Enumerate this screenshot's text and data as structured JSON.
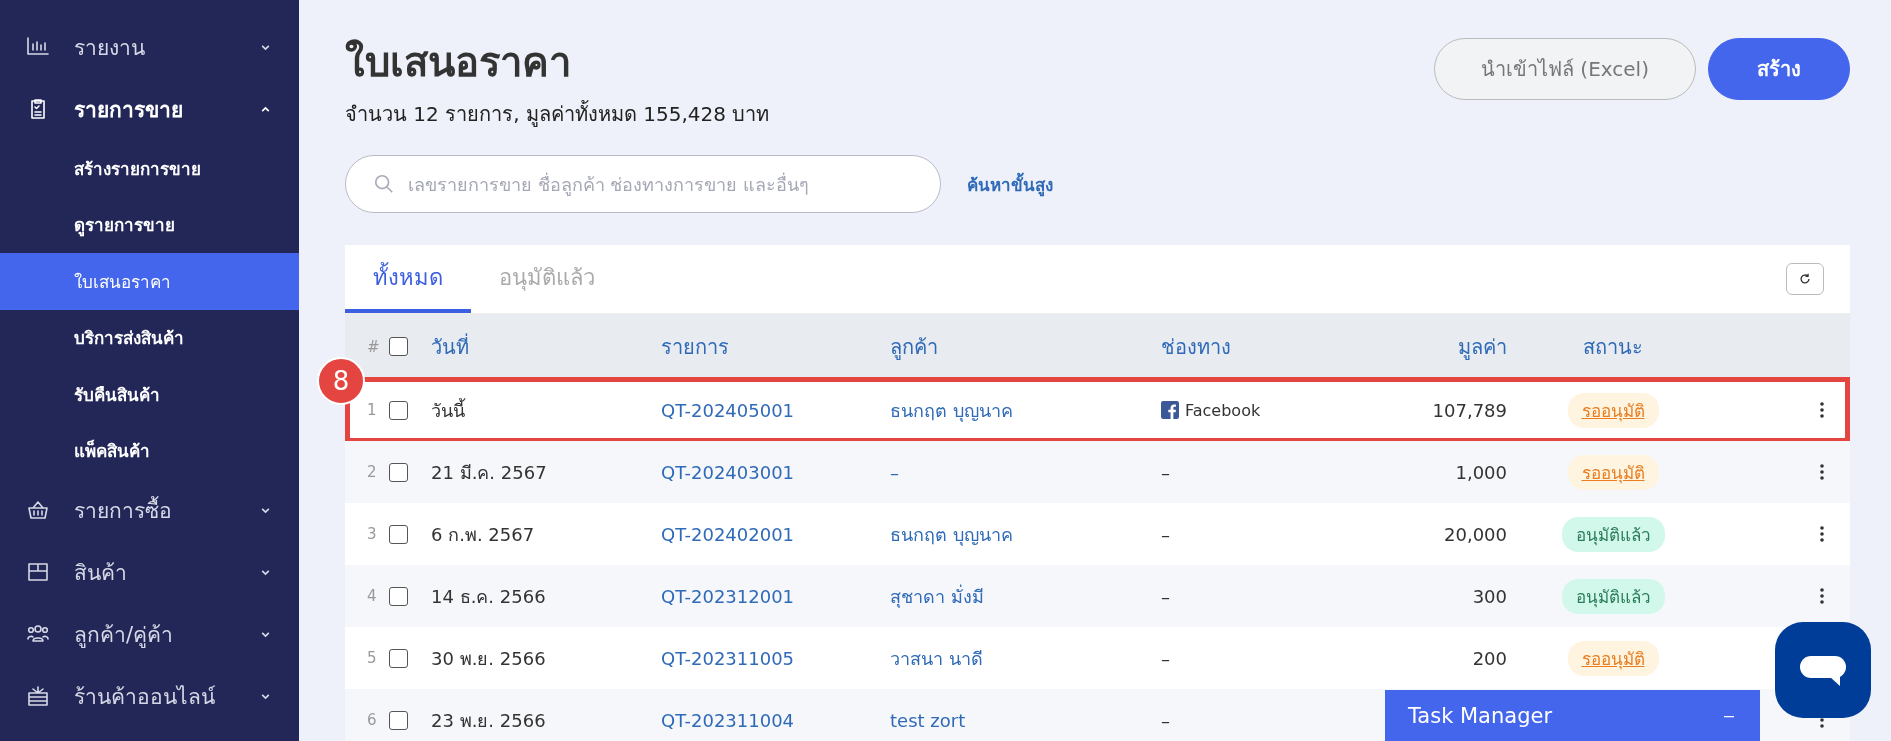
{
  "sidebar": {
    "items": [
      {
        "label": "รายงาน",
        "expanded": false,
        "bold": false
      },
      {
        "label": "รายการขาย",
        "expanded": true,
        "bold": true,
        "children": [
          {
            "label": "สร้างรายการขาย",
            "selected": false
          },
          {
            "label": "ดูรายการขาย",
            "selected": false
          },
          {
            "label": "ใบเสนอราคา",
            "selected": true
          },
          {
            "label": "บริการส่งสินค้า",
            "selected": false
          },
          {
            "label": "รับคืนสินค้า",
            "selected": false
          },
          {
            "label": "แพ็คสินค้า",
            "selected": false
          }
        ]
      },
      {
        "label": "รายการซื้อ",
        "expanded": false,
        "bold": false
      },
      {
        "label": "สินค้า",
        "expanded": false,
        "bold": false
      },
      {
        "label": "ลูกค้า/คู่ค้า",
        "expanded": false,
        "bold": false
      },
      {
        "label": "ร้านค้าออนไลน์",
        "expanded": false,
        "bold": false
      }
    ]
  },
  "page": {
    "title": "ใบเสนอราคา",
    "summary": "จำนวน 12 รายการ, มูลค่าทั้งหมด 155,428 บาท"
  },
  "buttons": [
    {
      "label": "นำเข้าไฟล์ (Excel)",
      "kind": "secondary"
    },
    {
      "label": "สร้าง",
      "kind": "primary"
    }
  ],
  "search": {
    "placeholder": "เลขรายการขาย ชื่อลูกค้า ช่องทางการขาย และอื่นๆ",
    "advanced_link": "ค้นหาขั้นสูง"
  },
  "tabs": [
    {
      "label": "ทั้งหมด",
      "selected": true
    },
    {
      "label": "อนุมัติแล้ว",
      "selected": false
    }
  ],
  "table": {
    "columns": [
      "#",
      "วันที่",
      "รายการ",
      "ลูกค้า",
      "ช่องทาง",
      "มูลค่า",
      "สถานะ"
    ],
    "header_checked": false,
    "rows": [
      {
        "index": "1",
        "checked": false,
        "date": "วันนี้",
        "number": "QT-202405001",
        "customer": "ธนกฤต บุญนาค",
        "channel": "Facebook",
        "channel_icon": true,
        "value": "107,789",
        "status": "รออนุมัติ",
        "approved": false,
        "highlighted": true
      },
      {
        "index": "2",
        "checked": false,
        "date": "21 มี.ค. 2567",
        "number": "QT-202403001",
        "customer": "–",
        "channel": "–",
        "channel_icon": false,
        "value": "1,000",
        "status": "รออนุมัติ",
        "approved": false,
        "highlighted": false
      },
      {
        "index": "3",
        "checked": false,
        "date": "6 ก.พ. 2567",
        "number": "QT-202402001",
        "customer": "ธนกฤต บุญนาค",
        "channel": "–",
        "channel_icon": false,
        "value": "20,000",
        "status": "อนุมัติแล้ว",
        "approved": true,
        "highlighted": false
      },
      {
        "index": "4",
        "checked": false,
        "date": "14 ธ.ค. 2566",
        "number": "QT-202312001",
        "customer": "สุชาดา มั่งมี",
        "channel": "–",
        "channel_icon": false,
        "value": "300",
        "status": "อนุมัติแล้ว",
        "approved": true,
        "highlighted": false
      },
      {
        "index": "5",
        "checked": false,
        "date": "30 พ.ย. 2566",
        "number": "QT-202311005",
        "customer": "วาสนา นาดี",
        "channel": "–",
        "channel_icon": false,
        "value": "200",
        "status": "รออนุมัติ",
        "approved": false,
        "highlighted": false
      },
      {
        "index": "6",
        "checked": false,
        "date": "23 พ.ย. 2566",
        "number": "QT-202311004",
        "customer": "test zort",
        "channel": "–",
        "channel_icon": false,
        "highlighted": false
      }
    ]
  },
  "step_badge": "8",
  "task_manager": {
    "title": "Task Manager",
    "minimize": "–"
  }
}
